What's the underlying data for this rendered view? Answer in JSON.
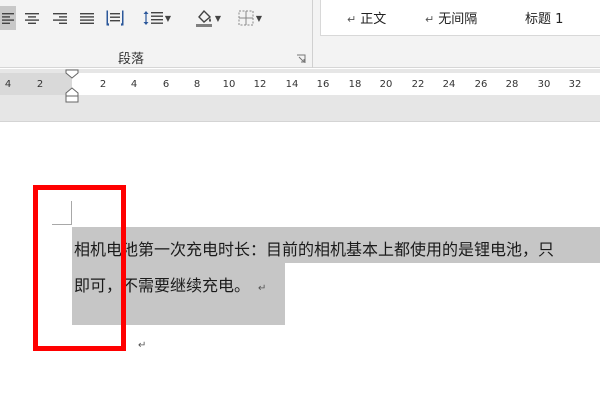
{
  "ribbon": {
    "paragraph_group_label": "段落",
    "styles": [
      {
        "mark": "↵",
        "label": "正文"
      },
      {
        "mark": "↵",
        "label": "无间隔"
      },
      {
        "mark": "",
        "label": "标题 1"
      }
    ],
    "icons": [
      "align-justify-active-icon",
      "align-center-icon",
      "align-right-icon",
      "justify-icon",
      "distributed-icon",
      "line-spacing-icon",
      "shading-icon",
      "borders-icon"
    ]
  },
  "ruler": {
    "ticks": [
      "4",
      "2",
      "2",
      "4",
      "6",
      "8",
      "10",
      "12",
      "14",
      "16",
      "18",
      "20",
      "22",
      "24",
      "26",
      "28",
      "30",
      "32"
    ]
  },
  "document": {
    "line1": "相机电池第一次充电时长：目前的相机基本上都使用的是锂电池，只",
    "line2": "即可，不需要继续充电。",
    "paragraph_mark": "↵"
  },
  "colors": {
    "selection": "#c6c6c6",
    "highlight_box": "#ff0000",
    "ribbon_bg": "#f3f3f3"
  }
}
